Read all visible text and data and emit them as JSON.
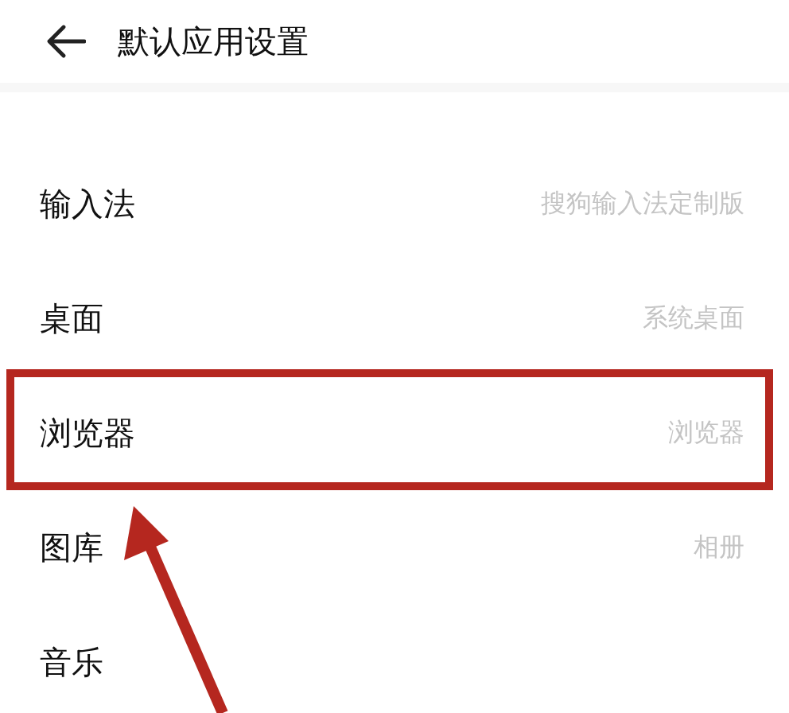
{
  "header": {
    "title": "默认应用设置"
  },
  "rows": [
    {
      "label": "输入法",
      "value": "搜狗输入法定制版",
      "highlighted": false
    },
    {
      "label": "桌面",
      "value": "系统桌面",
      "highlighted": false
    },
    {
      "label": "浏览器",
      "value": "浏览器",
      "highlighted": true
    },
    {
      "label": "图库",
      "value": "相册",
      "highlighted": false
    },
    {
      "label": "音乐",
      "highlighted": false
    }
  ]
}
